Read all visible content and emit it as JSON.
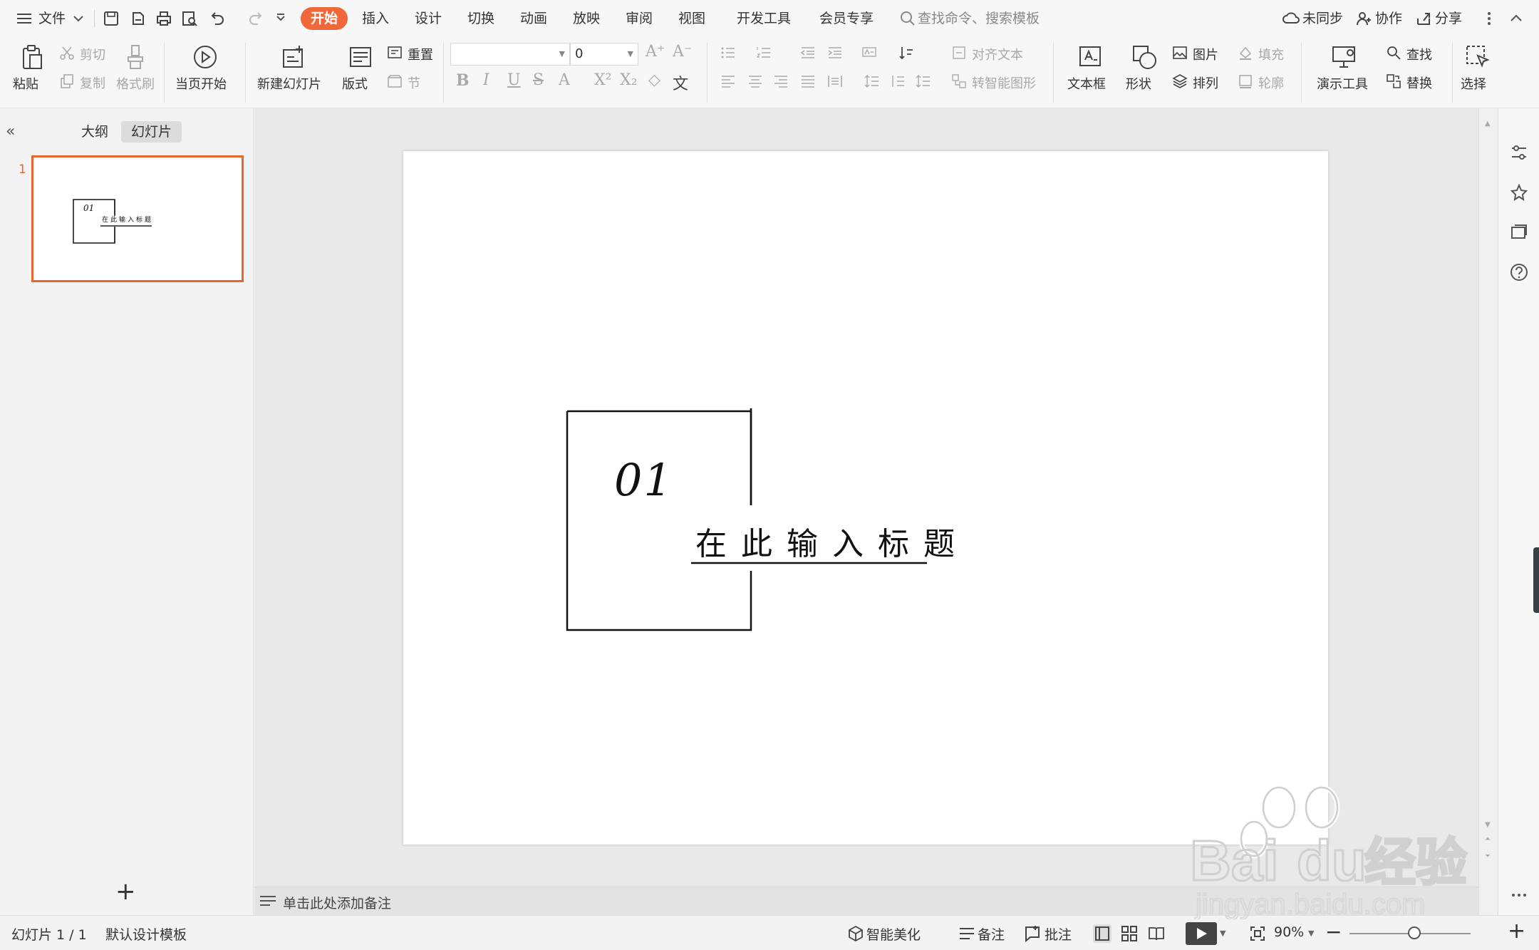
{
  "menubar": {
    "file_label": "文件",
    "tabs": [
      "开始",
      "插入",
      "设计",
      "切换",
      "动画",
      "放映",
      "审阅",
      "视图",
      "开发工具",
      "会员专享"
    ],
    "active_tab": "开始",
    "search_placeholder": "查找命令、搜索模板",
    "sync_label": "未同步",
    "collab_label": "协作",
    "share_label": "分享"
  },
  "ribbon": {
    "paste": "粘贴",
    "cut": "剪切",
    "copy": "复制",
    "format_painter": "格式刷",
    "from_current": "当页开始",
    "new_slide": "新建幻灯片",
    "layout": "版式",
    "reset": "重置",
    "section": "节",
    "font_name": "",
    "font_size": "0",
    "align_text": "对齐文本",
    "smart_shape": "转智能图形",
    "text_box": "文本框",
    "shape": "形状",
    "picture": "图片",
    "arrange": "排列",
    "fill": "填充",
    "outline": "轮廓",
    "presentation_tools": "演示工具",
    "find": "查找",
    "replace": "替换",
    "select": "选择"
  },
  "left_panel": {
    "tab_outline": "大纲",
    "tab_slides": "幻灯片",
    "slide_number": "1"
  },
  "slide": {
    "number": "01",
    "title": "在此输入标题"
  },
  "notes_placeholder": "单击此处添加备注",
  "status": {
    "slide_counter": "幻灯片 1 / 1",
    "template": "默认设计模板",
    "smart_beautify": "智能美化",
    "notes": "备注",
    "comments": "批注",
    "zoom": "90%"
  },
  "colors": {
    "accent": "#f0673a",
    "thumb_border": "#e8652e"
  },
  "watermark": {
    "brand": "Bai",
    "brand2": "du",
    "cn": "经验",
    "url": "jingyan.baidu.com"
  }
}
